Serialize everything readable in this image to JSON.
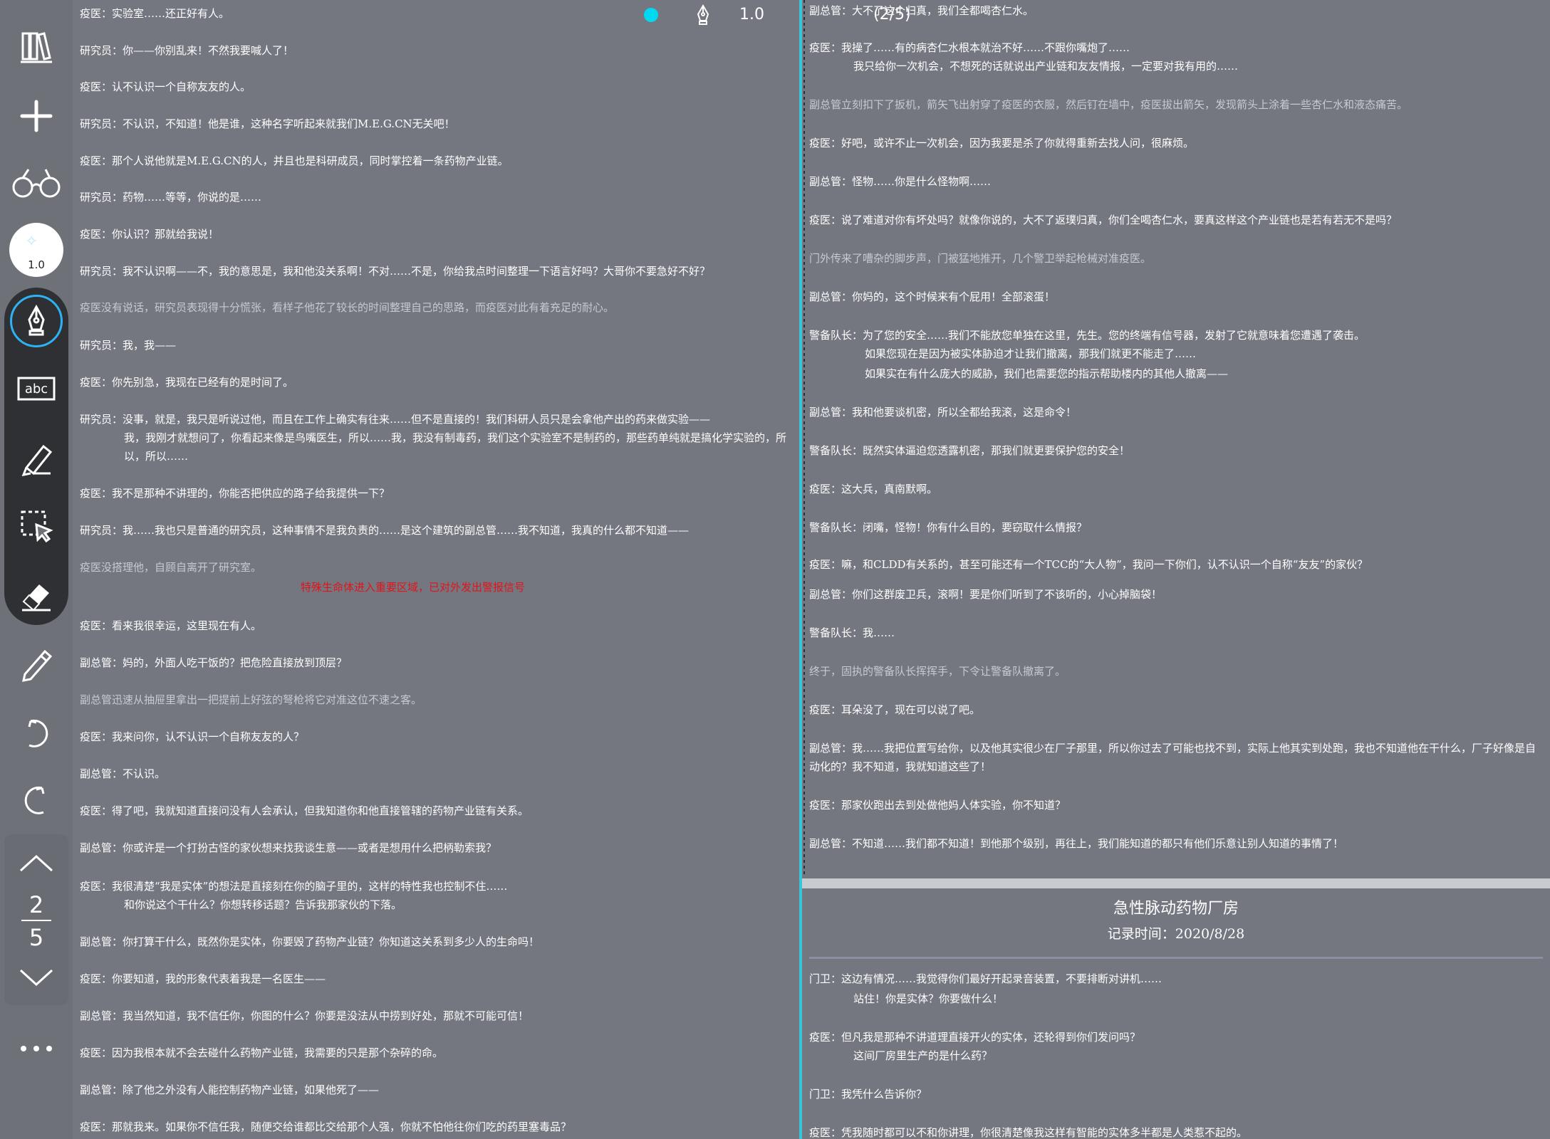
{
  "toolbar": {
    "brush_width": "1.0",
    "page_current": "2",
    "page_total": "5",
    "tools": [
      "library-icon",
      "add-icon",
      "reading-glasses-icon",
      "brush-size-icon",
      "pen-icon",
      "text-tool-icon",
      "highlighter-icon",
      "lasso-select-icon",
      "eraser-icon",
      "pencil-icon",
      "undo-icon",
      "redo-icon",
      "page-up-icon",
      "page-down-icon",
      "more-icon"
    ]
  },
  "header": {
    "pen_width": "1.0",
    "page_indicator": "(2/5)",
    "pen_color": "#00d9f2"
  },
  "left": [
    "疫医：实验室……还正好有人。",
    "研究员：你——你别乱来！不然我要喊人了！",
    "疫医：认不认识一个自称友友的人。",
    "研究员：不认识，不知道！他是谁，这种名字听起来就我们M.E.G.CN无关吧！",
    "疫医：那个人说他就是M.E.G.CN的人，并且也是科研成员，同时掌控着一条药物产业链。",
    "研究员：药物……等等，你说的是……",
    "疫医：你认识？那就给我说！",
    "研究员：我不认识啊——不，我的意思是，我和他没关系啊！不对……不是，你给我点时间整理一下语言好吗？大哥你不要急好不好？",
    "疫医没有说话，研究员表现得十分慌张，看样子他花了较长的时间整理自己的思路，而疫医对此有着充足的耐心。",
    "研究员：我，我——",
    "疫医：你先别急，我现在已经有的是时间了。",
    "研究员：没事，就是，我只是听说过他，而且在工作上确实有往来……但不是直接的！我们科研人员只是会拿他产出的药来做实验——",
    "我，我刚才就想问了，你看起来像是鸟嘴医生，所以……我，我没有制毒药，我们这个实验室不是制药的，那些药单纯就是搞化学实验的，所以，所以……",
    "疫医：我不是那种不讲理的，你能否把供应的路子给我提供一下？",
    "研究员：我……我也只是普通的研究员，这种事情不是我负责的……是这个建筑的副总管……我不知道，我真的什么都不知道——",
    "疫医没搭理他，自顾自离开了研究室。",
    "特殊生命体进入重要区域，已对外发出警报信号",
    "疫医：看来我很幸运，这里现在有人。",
    "副总管：妈的，外面人吃干饭的？把危险直接放到顶层？",
    "副总管迅速从抽屉里拿出一把提前上好弦的弩枪将它对准这位不速之客。",
    "疫医：我来问你，认不认识一个自称友友的人？",
    "副总管：不认识。",
    "疫医：得了吧，我就知道直接问没有人会承认，但我知道你和他直接管辖的药物产业链有关系。",
    "副总管：你或许是一个打扮古怪的家伙想来找我谈生意——或者是想用什么把柄勒索我？",
    "疫医：我很清楚“我是实体”的想法是直接刻在你的脑子里的，这样的特性我也控制不住……",
    "和你说这个干什么？你想转移话题？告诉我那家伙的下落。",
    "副总管：你打算干什么，既然你是实体，你要毁了药物产业链？你知道这关系到多少人的生命吗！",
    "疫医：你要知道，我的形象代表着我是一名医生——",
    "副总管：我当然知道，我不信任你，你图的什么？你要是没法从中捞到好处，那就不可能可信！",
    "疫医：因为我根本就不会去碰什么药物产业链，我需要的只是那个杂碎的命。",
    "副总管：除了他之外没有人能控制药物产业链，如果他死了——",
    "疫医：那就我来。如果你不信任我，随便交给谁都比交给那个人强，你就不怕他往你们吃的药里塞毒品？"
  ],
  "right": [
    "副总管：大不了这个归真，我们全都喝杏仁水。",
    "疫医：我操了……有的病杏仁水根本就治不好……不跟你嘴炮了……",
    "我只给你一次机会，不想死的话就说出产业链和友友情报，一定要对我有用的……",
    "副总管立刻扣下了扳机，箭矢飞出射穿了疫医的衣服，然后钉在墙中，疫医拔出箭矢，发现箭头上涂着一些杏仁水和液态痛苦。",
    "疫医：好吧，或许不止一次机会，因为我要是杀了你就得重新去找人问，很麻烦。",
    "副总管：怪物……你是什么怪物啊……",
    "疫医：说了难道对你有坏处吗？就像你说的，大不了返璞归真，你们全喝杏仁水，要真这样这个产业链也是若有若无不是吗？",
    "门外传来了嘈杂的脚步声，门被猛地推开，几个警卫举起枪械对准疫医。",
    "副总管：你妈的，这个时候来有个屁用！全部滚蛋！",
    "警备队长：为了您的安全……我们不能放您单独在这里，先生。您的终端有信号器，发射了它就意味着您遭遇了袭击。",
    "如果您现在是因为被实体胁迫才让我们撤离，那我们就更不能走了……",
    "如果实在有什么庞大的威胁，我们也需要您的指示帮助楼内的其他人撤离——",
    "副总管：我和他要谈机密，所以全都给我滚，这是命令！",
    "警备队长：既然实体逼迫您透露机密，那我们就更要保护您的安全！",
    "疫医：这大兵，真南默啊。",
    "警备队长：闭嘴，怪物！你有什么目的，要窃取什么情报？",
    "疫医：嘛，和CLDD有关系的，甚至可能还有一个TCC的“大人物”，我问一下你们，认不认识一个自称“友友”的家伙？",
    "副总管：你们这群废卫兵，滚啊！要是你们听到了不该听的，小心掉脑袋！",
    "警备队长：我……",
    "终于，固执的警备队长挥挥手，下令让警备队撤离了。",
    "疫医：耳朵没了，现在可以说了吧。",
    "副总管：我……我把位置写给你，以及他其实很少在厂子那里，所以你过去了可能也找不到，实际上他其实到处跑，我也不知道他在干什么，厂子好像是自动化的？我不知道，我就知道这些了！",
    "疫医：那家伙跑出去到处做他妈人体实验，你不知道？",
    "副总管：不知道……我们都不知道！到他那个级别，再往上，我们能知道的都只有他们乐意让别人知道的事情了！"
  ],
  "doc2": {
    "title": "急性脉动药物厂房",
    "date": "记录时间：2020/8/28",
    "lines": [
      "门卫：这边有情况……我觉得你们最好开起录音装置，不要排断对讲机……",
      "站住！你是实体？你要做什么！",
      "疫医：但凡我是那种不讲道理直接开火的实体，还轮得到你们发问吗？",
      "这间厂房里生产的是什么药？",
      "门卫：我凭什么告诉你？",
      "疫医：凭我随时都可以不和你讲理，你很清楚像我这样有智能的实体多半都是人类惹不起的。"
    ]
  }
}
